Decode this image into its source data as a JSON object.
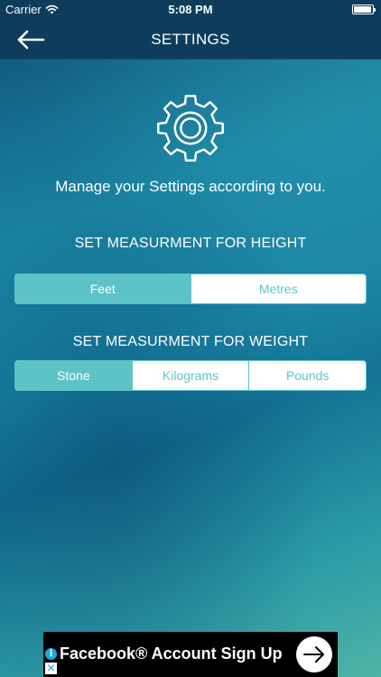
{
  "status_bar": {
    "carrier": "Carrier",
    "time": "5:08 PM",
    "wifi_icon": "wifi-icon",
    "battery_icon": "battery-icon"
  },
  "nav": {
    "title": "SETTINGS",
    "back_icon": "arrow-left-icon"
  },
  "main": {
    "gear_icon": "gear-icon",
    "tagline": "Manage your Settings according to you.",
    "height": {
      "heading": "SET MEASURMENT FOR HEIGHT",
      "options": [
        "Feet",
        "Metres"
      ],
      "selected": "Feet"
    },
    "weight": {
      "heading": "SET MEASURMENT FOR WEIGHT",
      "options": [
        "Stone",
        "Kilograms",
        "Pounds"
      ],
      "selected": "Stone"
    }
  },
  "ad": {
    "text": "Facebook® Account Sign Up",
    "info_icon": "info-icon",
    "close_icon": "close-icon",
    "arrow_icon": "arrow-right-icon"
  },
  "colors": {
    "nav_bg": "#0e3d5c",
    "accent": "#5ec3c6",
    "ad_bg": "#000000"
  }
}
